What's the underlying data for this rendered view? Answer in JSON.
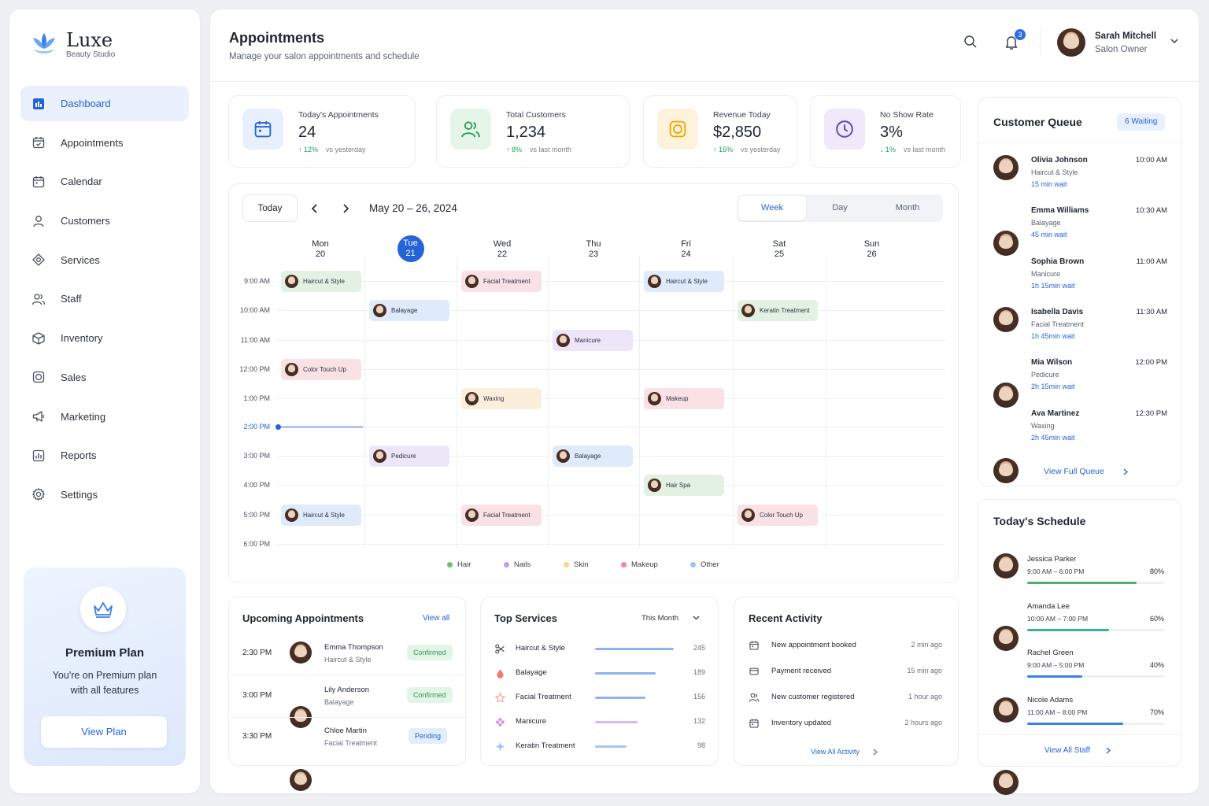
{
  "brand": {
    "name": "Luxe",
    "tagline": "Beauty Studio"
  },
  "nav": [
    {
      "label": "Dashboard",
      "icon": "dashboard-icon",
      "active": true
    },
    {
      "label": "Appointments",
      "icon": "calendar-check-icon"
    },
    {
      "label": "Calendar",
      "icon": "calendar-icon"
    },
    {
      "label": "Customers",
      "icon": "user-icon"
    },
    {
      "label": "Services",
      "icon": "diamond-icon"
    },
    {
      "label": "Staff",
      "icon": "users-icon"
    },
    {
      "label": "Inventory",
      "icon": "box-icon"
    },
    {
      "label": "Sales",
      "icon": "dollar-icon"
    },
    {
      "label": "Marketing",
      "icon": "megaphone-icon"
    },
    {
      "label": "Reports",
      "icon": "chart-icon"
    },
    {
      "label": "Settings",
      "icon": "gear-icon"
    }
  ],
  "premium": {
    "title": "Premium Plan",
    "desc": "You're on Premium plan with all features",
    "button": "View Plan"
  },
  "header": {
    "title": "Appointments",
    "subtitle": "Manage your salon appointments and schedule",
    "notifications": "3"
  },
  "user": {
    "name": "Sarah Mitchell",
    "role": "Salon Owner"
  },
  "stats": [
    {
      "label": "Today's Appointments",
      "value": "24",
      "trend": "↑ 12%",
      "compare": "vs yesterday",
      "color": "#2563d9",
      "bg": "#e8f0fd",
      "icon": "calendar-icon",
      "up": true
    },
    {
      "label": "Total Customers",
      "value": "1,234",
      "trend": "↑ 8%",
      "compare": "vs last month",
      "color": "#2f9a55",
      "bg": "#e5f5ea",
      "icon": "users-icon",
      "up": true
    },
    {
      "label": "Revenue Today",
      "value": "$2,850",
      "trend": "↑ 15%",
      "compare": "vs yesterday",
      "color": "#f0a500",
      "bg": "#fdf3dc",
      "icon": "dollar-icon",
      "up": true
    },
    {
      "label": "No Show Rate",
      "value": "3%",
      "trend": "↓ 1%",
      "compare": "vs last month",
      "color": "#6b46c1",
      "bg": "#efe9fb",
      "icon": "clock-icon",
      "up": false
    }
  ],
  "calendar": {
    "today_btn": "Today",
    "range": "May 20 – 26, 2024",
    "views": [
      "Week",
      "Day",
      "Month"
    ],
    "active_view": "Week",
    "days": [
      {
        "d": "Mon",
        "n": "20"
      },
      {
        "d": "Tue",
        "n": "21",
        "today": true
      },
      {
        "d": "Wed",
        "n": "22"
      },
      {
        "d": "Thu",
        "n": "23"
      },
      {
        "d": "Fri",
        "n": "24"
      },
      {
        "d": "Sat",
        "n": "25"
      },
      {
        "d": "Sun",
        "n": "26"
      }
    ],
    "times": [
      "9:00 AM",
      "10:00 AM",
      "11:00 AM",
      "12:00 PM",
      "1:00 PM",
      "2:00 PM",
      "3:00 PM",
      "4:00 PM",
      "5:00 PM",
      "6:00 PM"
    ],
    "now_label": "2:00 PM",
    "appointments": [
      {
        "label": "Haircut & Style",
        "cat": "hair",
        "day": 0,
        "slot": 0
      },
      {
        "label": "Color Touch Up",
        "cat": "makeup",
        "day": 0,
        "slot": 3
      },
      {
        "label": "Haircut & Style",
        "cat": "other",
        "day": 0,
        "slot": 8
      },
      {
        "label": "Balayage",
        "cat": "other",
        "day": 1,
        "slot": 1
      },
      {
        "label": "Pedicure",
        "cat": "nails",
        "day": 1,
        "slot": 6
      },
      {
        "label": "Facial Treatment",
        "cat": "makeup",
        "day": 2,
        "slot": 0
      },
      {
        "label": "Waxing",
        "cat": "skin",
        "day": 2,
        "slot": 4
      },
      {
        "label": "Facial Treatment",
        "cat": "makeup",
        "day": 2,
        "slot": 8
      },
      {
        "label": "Manicure",
        "cat": "nails",
        "day": 3,
        "slot": 2
      },
      {
        "label": "Balayage",
        "cat": "other",
        "day": 3,
        "slot": 6
      },
      {
        "label": "Haircut & Style",
        "cat": "other",
        "day": 4,
        "slot": 0
      },
      {
        "label": "Makeup",
        "cat": "makeup",
        "day": 4,
        "slot": 4
      },
      {
        "label": "Hair Spa",
        "cat": "hair",
        "day": 4,
        "slot": 7
      },
      {
        "label": "Keratin Treatment",
        "cat": "hair",
        "day": 5,
        "slot": 1
      },
      {
        "label": "Color Touch Up",
        "cat": "makeup",
        "day": 5,
        "slot": 8
      }
    ],
    "legend": [
      {
        "label": "Hair",
        "color": "#6cc070"
      },
      {
        "label": "Nails",
        "color": "#c59be8"
      },
      {
        "label": "Skin",
        "color": "#f7d58d"
      },
      {
        "label": "Makeup",
        "color": "#ee8aa0"
      },
      {
        "label": "Other",
        "color": "#9cc4f2"
      }
    ]
  },
  "upcoming": {
    "title": "Upcoming Appointments",
    "link": "View all",
    "items": [
      {
        "time": "2:30 PM",
        "name": "Emma Thompson",
        "service": "Haircut & Style",
        "status": "Confirmed",
        "kind": "confirmed"
      },
      {
        "time": "3:00 PM",
        "name": "Lily Anderson",
        "service": "Balayage",
        "status": "Confirmed",
        "kind": "confirmed"
      },
      {
        "time": "3:30 PM",
        "name": "Chloe Martin",
        "service": "Facial Treatment",
        "status": "Pending",
        "kind": "pending"
      }
    ]
  },
  "services": {
    "title": "Top Services",
    "filter": "This Month",
    "items": [
      {
        "name": "Haircut & Style",
        "count": 245,
        "color": "#8fb3ee",
        "icon": "scissors-icon"
      },
      {
        "name": "Balayage",
        "count": 189,
        "color": "#8fb3ee",
        "icon": "drop-icon"
      },
      {
        "name": "Facial Treatment",
        "count": 156,
        "color": "#8fb3ee",
        "icon": "star-icon"
      },
      {
        "name": "Manicure",
        "count": 132,
        "color": "#dab6ee",
        "icon": "flower-icon"
      },
      {
        "name": "Keratin Treatment",
        "count": 98,
        "color": "#a9c6f2",
        "icon": "sparkle-icon"
      }
    ]
  },
  "activity": {
    "title": "Recent Activity",
    "link": "View All Activity",
    "items": [
      {
        "text": "New appointment booked",
        "time": "2 min ago",
        "icon": "calendar-icon"
      },
      {
        "text": "Payment received",
        "time": "15 min ago",
        "icon": "card-icon"
      },
      {
        "text": "New customer registered",
        "time": "1 hour ago",
        "icon": "users-icon"
      },
      {
        "text": "Inventory updated",
        "time": "2 hours ago",
        "icon": "calendar-icon"
      }
    ]
  },
  "queue": {
    "title": "Customer Queue",
    "badge": "6 Waiting",
    "link": "View Full Queue",
    "items": [
      {
        "name": "Olivia Johnson",
        "service": "Haircut & Style",
        "wait": "15 min wait",
        "time": "10:00 AM"
      },
      {
        "name": "Emma Williams",
        "service": "Balayage",
        "wait": "45 min wait",
        "time": "10:30 AM"
      },
      {
        "name": "Sophia Brown",
        "service": "Manicure",
        "wait": "1h 15min wait",
        "time": "11:00 AM"
      },
      {
        "name": "Isabella Davis",
        "service": "Facial Treatment",
        "wait": "1h 45min wait",
        "time": "11:30 AM"
      },
      {
        "name": "Mia Wilson",
        "service": "Pedicure",
        "wait": "2h 15min wait",
        "time": "12:00 PM"
      },
      {
        "name": "Ava Martinez",
        "service": "Waxing",
        "wait": "2h 45min wait",
        "time": "12:30 PM"
      }
    ]
  },
  "schedule": {
    "title": "Today's Schedule",
    "link": "View All Staff",
    "items": [
      {
        "name": "Jessica Parker",
        "hours": "9:00 AM – 6:00 PM",
        "pct": "80%",
        "val": 0.8,
        "color": "#4caf6a"
      },
      {
        "name": "Amanda Lee",
        "hours": "10:00 AM – 7:00 PM",
        "pct": "60%",
        "val": 0.6,
        "color": "#35b39a"
      },
      {
        "name": "Rachel Green",
        "hours": "9:00 AM – 5:00 PM",
        "pct": "40%",
        "val": 0.4,
        "color": "#3b82e6"
      },
      {
        "name": "Nicole Adams",
        "hours": "11:00 AM – 8:00 PM",
        "pct": "70%",
        "val": 0.7,
        "color": "#3b82e6"
      }
    ]
  }
}
